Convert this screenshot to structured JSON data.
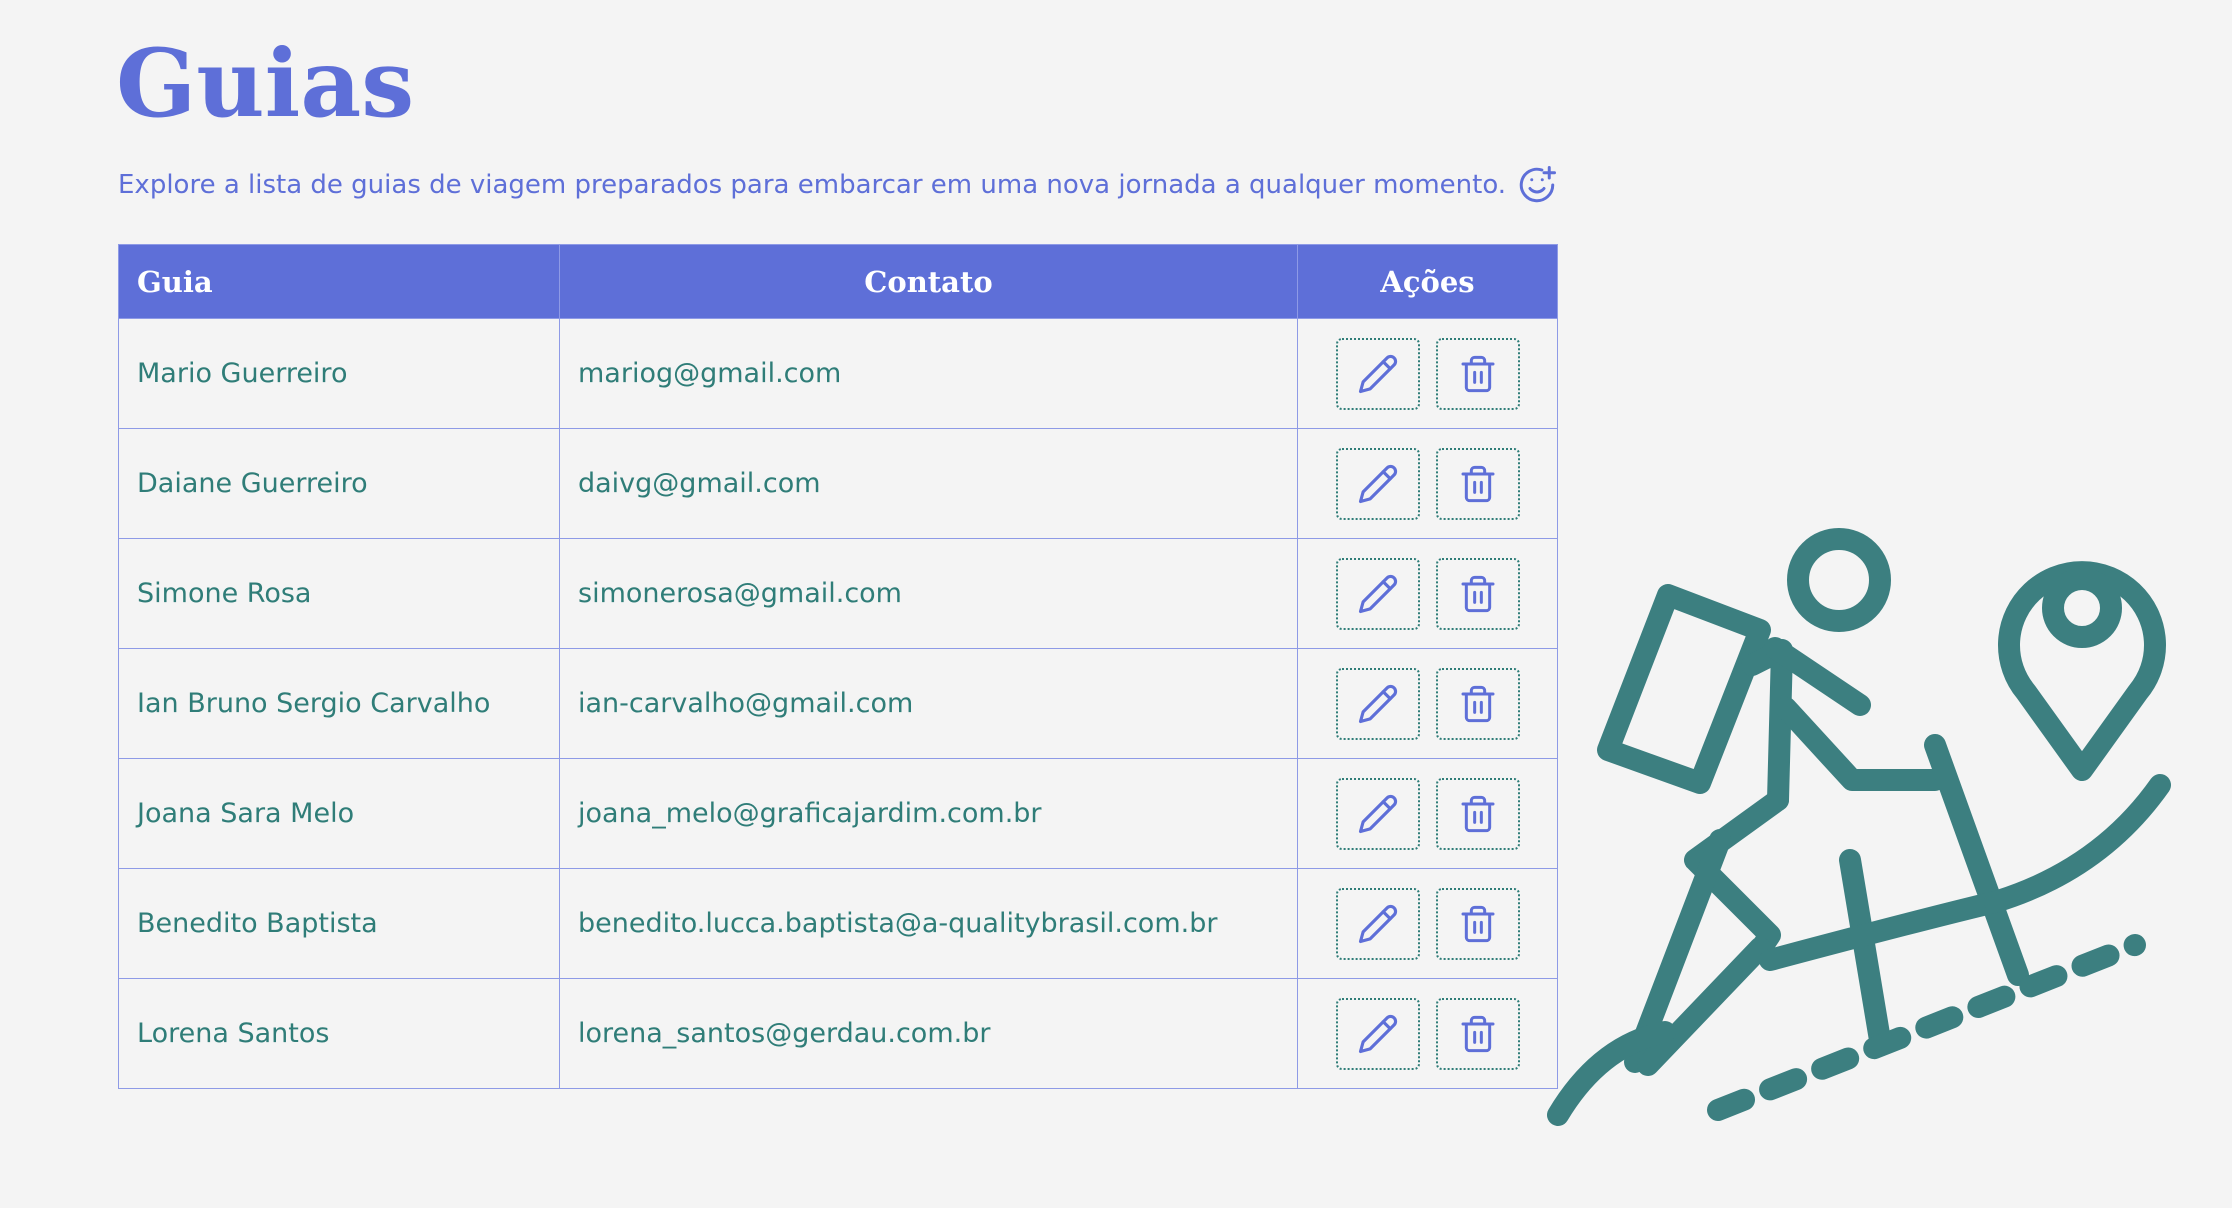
{
  "page": {
    "title": "Guias",
    "subtitle": "Explore a lista de guias de viagem preparados para embarcar em uma nova jornada a qualquer momento.",
    "subtitle_icon": "smile-plus-icon"
  },
  "table": {
    "headers": {
      "guide": "Guia",
      "contact": "Contato",
      "actions": "Ações"
    },
    "rows": [
      {
        "name": "Mario Guerreiro",
        "email": "mariog@gmail.com"
      },
      {
        "name": "Daiane Guerreiro",
        "email": "daivg@gmail.com"
      },
      {
        "name": "Simone Rosa",
        "email": "simonerosa@gmail.com"
      },
      {
        "name": "Ian Bruno Sergio Carvalho",
        "email": "ian-carvalho@gmail.com"
      },
      {
        "name": "Joana Sara Melo",
        "email": "joana_melo@graficajardim.com.br"
      },
      {
        "name": "Benedito Baptista",
        "email": "benedito.lucca.baptista@a-qualitybrasil.com.br"
      },
      {
        "name": "Lorena Santos",
        "email": "lorena_santos@gerdau.com.br"
      }
    ],
    "row_actions": {
      "edit_icon": "pencil-icon",
      "delete_icon": "trash-icon"
    }
  },
  "illustration": {
    "icon": "hiker-with-location-pin-icon"
  },
  "colors": {
    "accent": "#5e6fd8",
    "text_teal": "#2f7d78",
    "illustration": "#3c7f80",
    "background": "#f4f4f4",
    "table_border": "#8e9ae6",
    "header_text": "#ffffff"
  }
}
